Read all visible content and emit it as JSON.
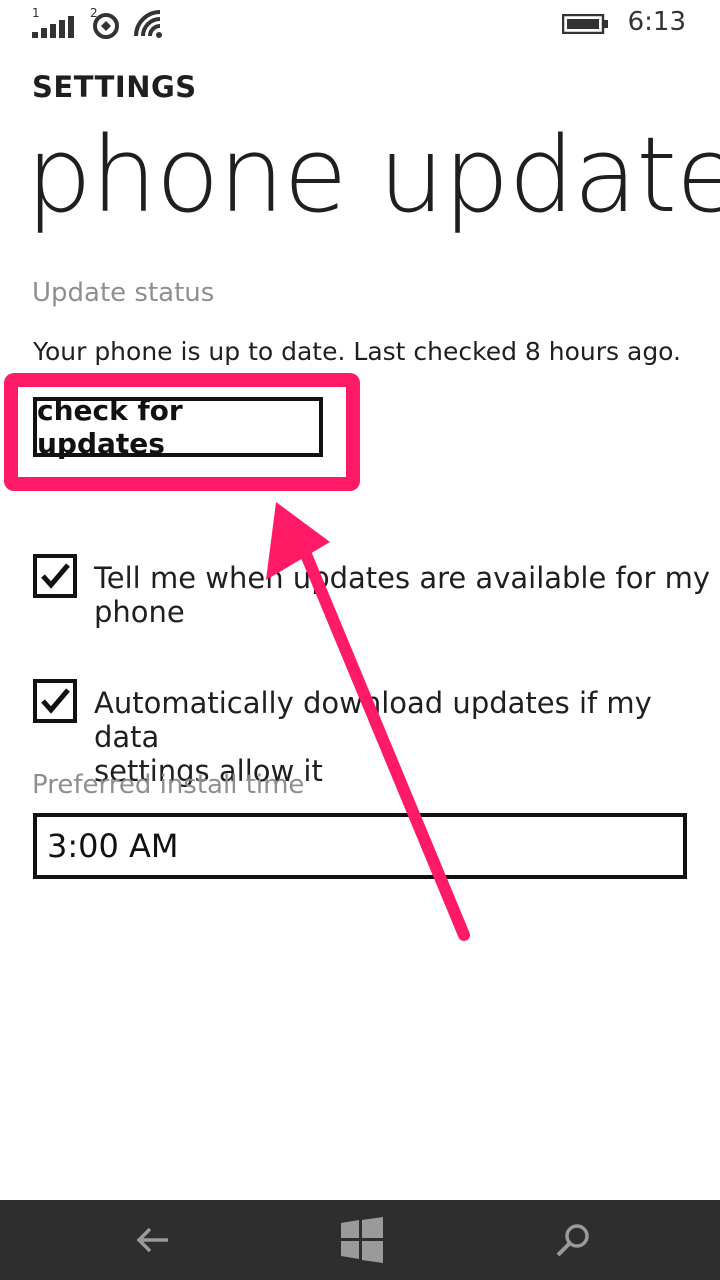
{
  "status_bar": {
    "signal_sim1": "1",
    "signal_sim2": "2",
    "time": "6:13",
    "icons": [
      "signal-icon",
      "sim-icon",
      "wifi-icon",
      "battery-icon"
    ]
  },
  "header": {
    "app_label": "SETTINGS",
    "page_title": "phone update"
  },
  "update_section": {
    "label": "Update status",
    "status_text": "Your phone is up to date. Last checked 8 hours ago.",
    "check_button_label": "check for updates"
  },
  "options": [
    {
      "label_line1": "Tell me when updates are available for my",
      "label_line2": "phone",
      "checked": true
    },
    {
      "label_line1": "Automatically download updates if my data",
      "label_line2": "settings allow it",
      "checked": true
    }
  ],
  "install_time": {
    "label": "Preferred install time",
    "value": "3:00 AM"
  },
  "nav": {
    "icons": [
      "back-icon",
      "windows-icon",
      "search-icon"
    ]
  },
  "colors": {
    "highlight": "#ff1a66",
    "navbar": "#2e2e2e",
    "label_gray": "#8f8f8f"
  }
}
